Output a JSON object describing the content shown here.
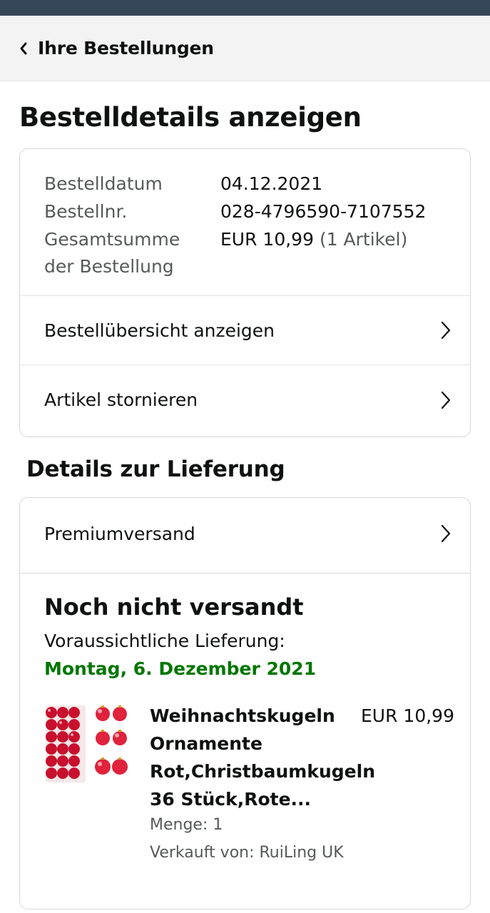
{
  "header": {
    "back_label": "Ihre Bestellungen"
  },
  "page": {
    "title": "Bestelldetails anzeigen"
  },
  "order_info": {
    "date_label": "Bestelldatum",
    "date_value": "04.12.2021",
    "number_label": "Bestellnr.",
    "number_value": "028-4796590-7107552",
    "total_label_line1": "Gesamtsumme",
    "total_label_line2": "der Bestellung",
    "total_value": "EUR 10,99",
    "total_count": "(1 Artikel)"
  },
  "actions": {
    "overview_label": "Bestellübersicht anzeigen",
    "cancel_label": "Artikel stornieren"
  },
  "delivery": {
    "section_title": "Details zur Lieferung",
    "shipping_label": "Premiumversand",
    "status": "Noch nicht versandt",
    "eta_label": "Voraussichtliche Lieferung:",
    "eta_date": "Montag, 6. Dezember 2021",
    "eta_color": "#007600"
  },
  "product": {
    "title": "Weihnachtskugeln Ornamente Rot,Christbaumkugeln 36 Stück,Rote...",
    "price": "EUR 10,99",
    "quantity": "Menge: 1",
    "seller": "Verkauft von: RuiLing UK",
    "image_icon": "red-christmas-ornaments-image"
  },
  "colors": {
    "top_bar": "#37475a",
    "nav_bg": "#f3f3f3",
    "border": "#d5d9d9"
  }
}
